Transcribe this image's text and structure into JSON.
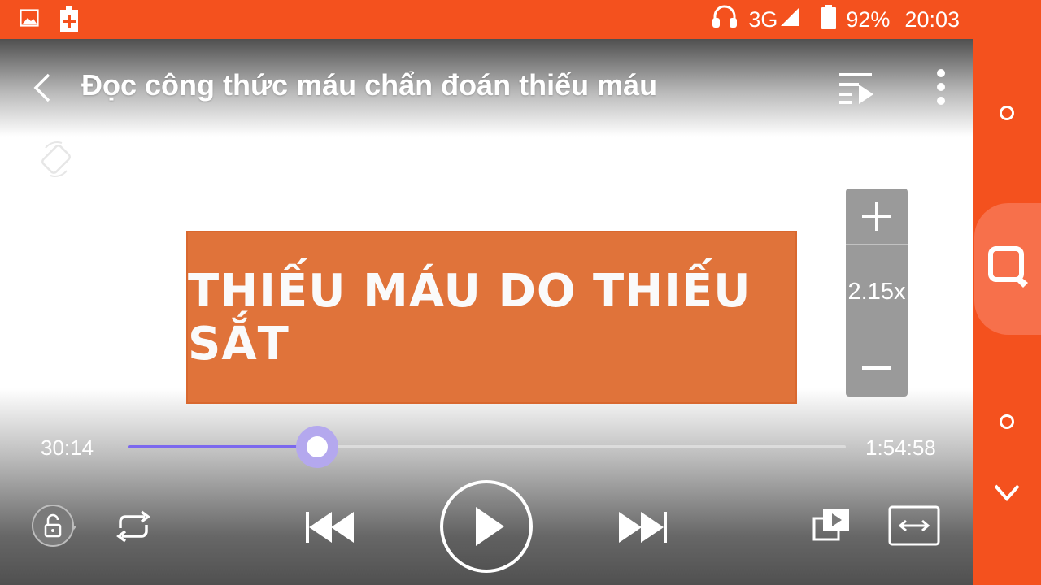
{
  "status_bar": {
    "network": "3G",
    "battery": "92%",
    "time": "20:03",
    "left_icons": [
      "gallery-icon",
      "battery-charging-icon"
    ],
    "right_icons": [
      "headset-icon",
      "signal-icon",
      "battery-icon"
    ]
  },
  "player": {
    "title": "Đọc công thức máu chẩn đoán thiếu máu",
    "slide_text": "THIẾU MÁU DO THIẾU SẮT",
    "zoom": {
      "value": "2.15x",
      "plus_icon": "plus-icon",
      "minus_icon": "minus-icon"
    },
    "progress": {
      "current": "30:14",
      "total": "1:54:58",
      "fraction": 0.2628
    },
    "controls": [
      "lock-icon",
      "repeat-icon",
      "skip-previous-icon",
      "play-icon",
      "skip-next-icon",
      "popup-play-icon",
      "aspect-ratio-icon"
    ]
  },
  "colors": {
    "accent": "#f4511e",
    "progress": "#7b68ee",
    "banner": "#e0733a"
  }
}
